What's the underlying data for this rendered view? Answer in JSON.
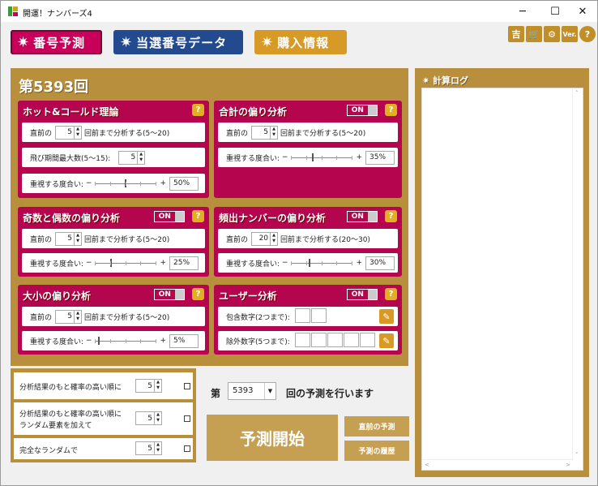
{
  "window": {
    "title": "開運！ナンバーズ4"
  },
  "nav": {
    "predict": "番号予測",
    "winning_data": "当選番号データ",
    "purchase": "購入情報"
  },
  "top_icons": {
    "kichi": "吉",
    "cart": "🛒",
    "gear": "⚙",
    "ver": "Ver.",
    "help": "?"
  },
  "main": {
    "round_title": "第5393回",
    "hot_cold": {
      "title": "ホット&コールド理論",
      "prev_label": "直前の",
      "prev_value": "5",
      "prev_suffix": "回前まで分析する(5〜20)",
      "jump_label": "飛び期間最大数(5〜15):",
      "jump_value": "5",
      "weight_label": "重視する度合い:",
      "weight_value": "50%",
      "weight_level": 0.5
    },
    "sum": {
      "title": "合計の偏り分析",
      "toggle": "ON",
      "prev_label": "直前の",
      "prev_value": "5",
      "prev_suffix": "回前まで分析する(5〜20)",
      "weight_label": "重視する度合い:",
      "weight_value": "35%",
      "weight_level": 0.35
    },
    "odd_even": {
      "title": "奇数と偶数の偏り分析",
      "toggle": "ON",
      "prev_label": "直前の",
      "prev_value": "5",
      "prev_suffix": "回前まで分析する(5〜20)",
      "weight_label": "重視する度合い:",
      "weight_value": "25%",
      "weight_level": 0.25
    },
    "frequent": {
      "title": "頻出ナンバーの偏り分析",
      "toggle": "ON",
      "prev_label": "直前の",
      "prev_value": "20",
      "prev_suffix": "回前まで分析する(20〜30)",
      "weight_label": "重視する度合い:",
      "weight_value": "30%",
      "weight_level": 0.3
    },
    "big_small": {
      "title": "大小の偏り分析",
      "toggle": "ON",
      "prev_label": "直前の",
      "prev_value": "5",
      "prev_suffix": "回前まで分析する(5〜20)",
      "weight_label": "重視する度合い:",
      "weight_value": "5%",
      "weight_level": 0.05
    },
    "user": {
      "title": "ユーザー分析",
      "toggle": "ON",
      "include_label": "包含数字(2つまで):",
      "exclude_label": "除外数字(5つまで):"
    }
  },
  "options": {
    "opt1": {
      "label": "分析結果のもと確率の高い順に",
      "value": "5"
    },
    "opt2": {
      "label1": "分析結果のもと確率の高い順に",
      "label2": "ランダム要素を加えて",
      "value": "5"
    },
    "opt3": {
      "label": "完全なランダムで",
      "value": "5"
    }
  },
  "predict": {
    "dai": "第",
    "round": "5393",
    "suffix": "回の予測を行います",
    "start": "予測開始",
    "prev_prediction": "直前の予測",
    "history": "予測の履歴"
  },
  "log": {
    "title": "計算ログ"
  },
  "colors": {
    "magenta": "#b5054f",
    "gold": "#b8903d",
    "blue": "#234a8e",
    "orange": "#d79a26"
  }
}
